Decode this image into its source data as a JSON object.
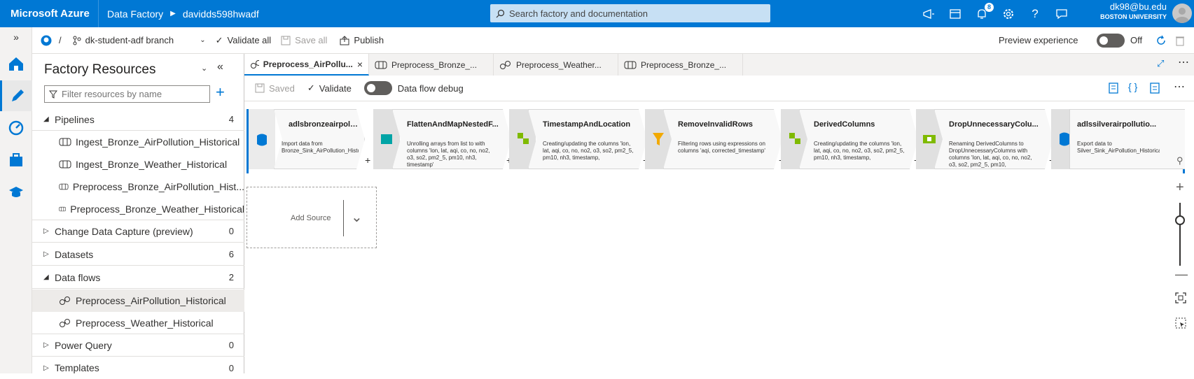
{
  "topbar": {
    "brand": "Microsoft Azure",
    "breadcrumb": [
      "Data Factory",
      "davidds598hwadf"
    ],
    "search_placeholder": "Search factory and documentation",
    "notification_count": "8",
    "user_email": "dk98@bu.edu",
    "user_org": "BOSTON UNIVERSITY",
    "accent": "#0078d4"
  },
  "subbar": {
    "branch": "dk-student-adf branch",
    "validate_all": "Validate all",
    "save_all": "Save all",
    "publish": "Publish",
    "preview_label": "Preview experience",
    "preview_state": "Off"
  },
  "resources": {
    "title": "Factory Resources",
    "filter_placeholder": "Filter resources by name",
    "sections": [
      {
        "label": "Pipelines",
        "count": "4"
      },
      {
        "label": "Change Data Capture (preview)",
        "count": "0"
      },
      {
        "label": "Datasets",
        "count": "6"
      },
      {
        "label": "Data flows",
        "count": "2"
      },
      {
        "label": "Power Query",
        "count": "0"
      },
      {
        "label": "Templates",
        "count": "0"
      }
    ],
    "pipelines": [
      "Ingest_Bronze_AirPollution_Historical",
      "Ingest_Bronze_Weather_Historical",
      "Preprocess_Bronze_AirPollution_Hist...",
      "Preprocess_Bronze_Weather_Historical"
    ],
    "dataflows": [
      "Preprocess_AirPollution_Historical",
      "Preprocess_Weather_Historical"
    ]
  },
  "tabs": [
    {
      "label": "Preprocess_AirPollu...",
      "icon": "dataflow-icon"
    },
    {
      "label": "Preprocess_Bronze_...",
      "icon": "pipeline-icon"
    },
    {
      "label": "Preprocess_Weather...",
      "icon": "dataflow-icon"
    },
    {
      "label": "Preprocess_Bronze_...",
      "icon": "pipeline-icon"
    }
  ],
  "editor_toolbar": {
    "saved": "Saved",
    "validate": "Validate",
    "debug": "Data flow debug"
  },
  "flow": {
    "nodes": [
      {
        "title": "adlsbronzeairpolluti...",
        "desc": "Import data from Bronze_Sink_AirPollution_Historical"
      },
      {
        "title": "FlattenAndMapNestedF...",
        "desc": "Unrolling arrays from list to with columns 'lon, lat, aqi, co, no, no2, o3, so2, pm2_5, pm10, nh3, timestamp'"
      },
      {
        "title": "TimestampAndLocation",
        "desc": "Creating/updating the columns 'lon, lat, aqi, co, no, no2, o3, so2, pm2_5, pm10, nh3, timestamp,"
      },
      {
        "title": "RemoveInvalidRows",
        "desc": "Filtering rows using expressions on columns 'aqi, corrected_timestamp'"
      },
      {
        "title": "DerivedColumns",
        "desc": "Creating/updating the columns 'lon, lat, aqi, co, no, no2, o3, so2, pm2_5, pm10, nh3, timestamp,"
      },
      {
        "title": "DropUnnecessaryColu...",
        "desc": "Renaming DerivedColumns to DropUnnecessaryColumns with columns 'lon, lat, aqi, co, no, no2, o3, so2, pm2_5, pm10,"
      },
      {
        "title": "adlssilverairpollutio...",
        "desc": "Export data to Silver_Sink_AirPollution_Historical"
      }
    ],
    "add_source": "Add Source"
  }
}
